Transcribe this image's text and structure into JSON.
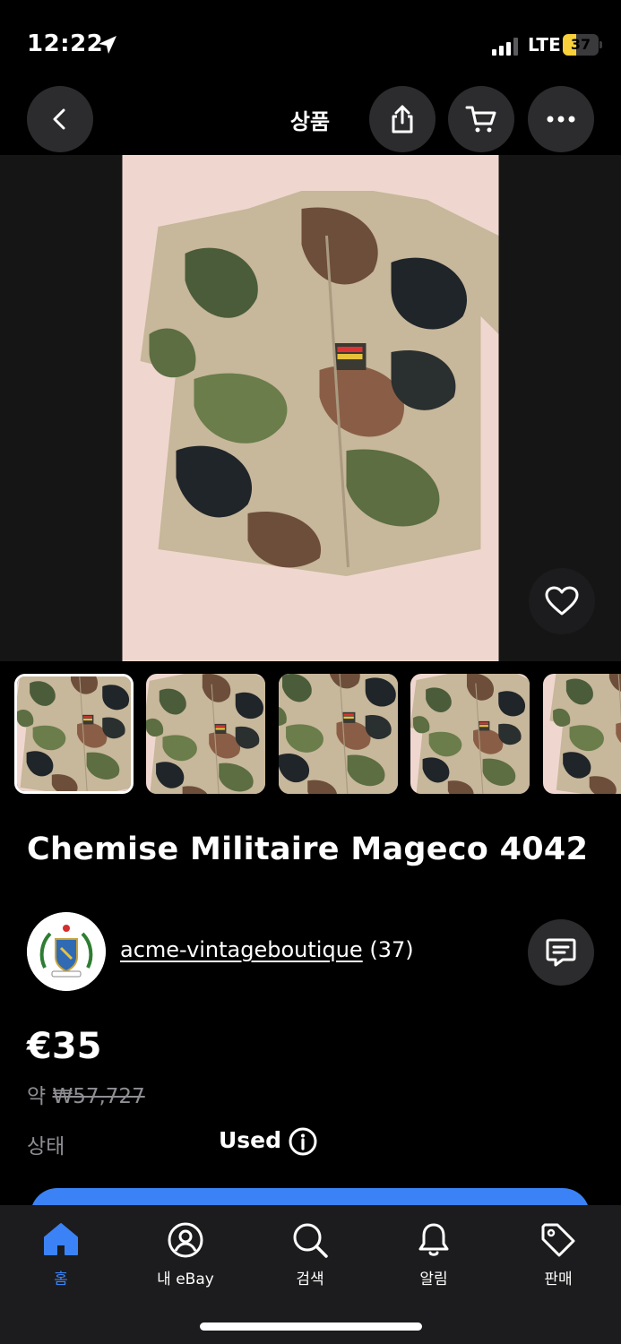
{
  "status_bar": {
    "time": "12:22",
    "network": "LTE",
    "battery": "37",
    "battery_percent": 37
  },
  "nav": {
    "title": "상품",
    "icons": [
      "back-arrow-icon",
      "share-icon",
      "cart-icon",
      "more-icon"
    ]
  },
  "listing": {
    "title": "Chemise Militaire Mageco 4042",
    "image_count_visible": 5,
    "selected_thumbnail": 1
  },
  "seller": {
    "name": "acme-vintageboutique",
    "feedback": "(37)"
  },
  "price": {
    "main": "€35",
    "approx_prefix": "약",
    "approx_value": "₩57,727"
  },
  "condition": {
    "label": "상태",
    "value": "Used"
  },
  "tabbar": {
    "items": [
      {
        "label": "홈",
        "icon": "home-icon",
        "active": true
      },
      {
        "label": "내 eBay",
        "icon": "user-icon",
        "active": false
      },
      {
        "label": "검색",
        "icon": "search-icon",
        "active": false
      },
      {
        "label": "알림",
        "icon": "bell-icon",
        "active": false
      },
      {
        "label": "판매",
        "icon": "tag-icon",
        "active": false
      }
    ]
  },
  "colors": {
    "accent": "#3b82f6",
    "battery": "#f7d03b",
    "background": "#000000",
    "muted_text": "#8e8e93"
  }
}
